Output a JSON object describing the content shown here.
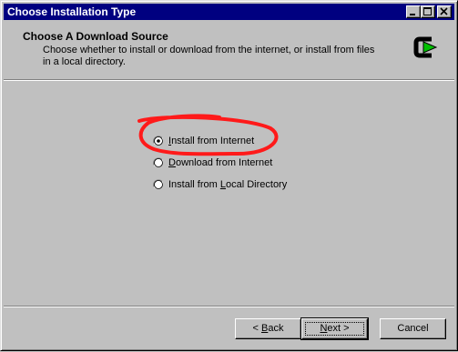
{
  "window": {
    "title": "Choose Installation Type",
    "controls": [
      "minimize-icon",
      "maximize-icon",
      "close-icon"
    ]
  },
  "header": {
    "title": "Choose A Download Source",
    "description": "Choose whether to install or download from the internet, or install from files in a local directory.",
    "icon": "cygwin-logo-icon"
  },
  "options": [
    {
      "pre": "",
      "accel": "I",
      "post": "nstall from Internet",
      "selected": true
    },
    {
      "pre": "",
      "accel": "D",
      "post": "ownload from Internet",
      "selected": false
    },
    {
      "pre": "Install from ",
      "accel": "L",
      "post": "ocal Directory",
      "selected": false
    }
  ],
  "buttons": {
    "back_pre": "< ",
    "back_accel": "B",
    "back_post": "ack",
    "next_pre": "",
    "next_accel": "N",
    "next_post": "ext >",
    "cancel": "Cancel"
  },
  "colors": {
    "titlebar": "#000080",
    "annotation": "#ff1a1a",
    "logo_green": "#00c000"
  }
}
